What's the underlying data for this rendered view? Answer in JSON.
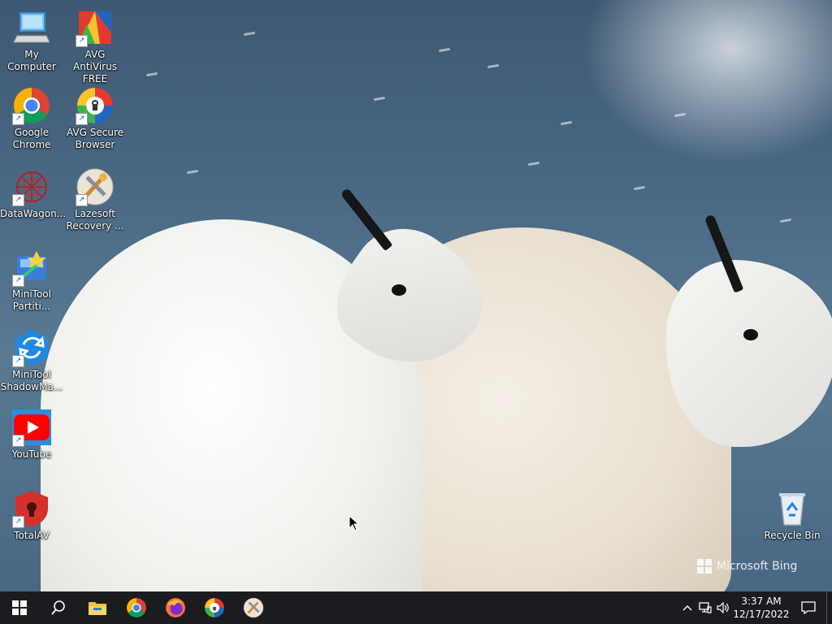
{
  "desktop": {
    "icons": [
      {
        "label": "My Computer"
      },
      {
        "label": "AVG AntiVirus FREE"
      },
      {
        "label": "Google Chrome"
      },
      {
        "label": "AVG Secure Browser"
      },
      {
        "label": "DataWagon..."
      },
      {
        "label": "Lazesoft Recovery ..."
      },
      {
        "label": "MiniTool Partiti..."
      },
      {
        "label": "MiniTool ShadowMa..."
      },
      {
        "label": "YouTube"
      },
      {
        "label": "TotalAV"
      },
      {
        "label": "Recycle Bin"
      }
    ],
    "watermark": "Microsoft Bing"
  },
  "taskbar": {
    "apps": [
      {
        "icon": "windows-start-icon"
      },
      {
        "icon": "search-icon"
      },
      {
        "icon": "file-explorer-icon"
      },
      {
        "icon": "chrome-icon"
      },
      {
        "icon": "firefox-icon"
      },
      {
        "icon": "avg-secure-browser-icon"
      },
      {
        "icon": "lazesoft-icon"
      }
    ],
    "clock": {
      "time": "3:37 AM",
      "date": "12/17/2022"
    }
  }
}
